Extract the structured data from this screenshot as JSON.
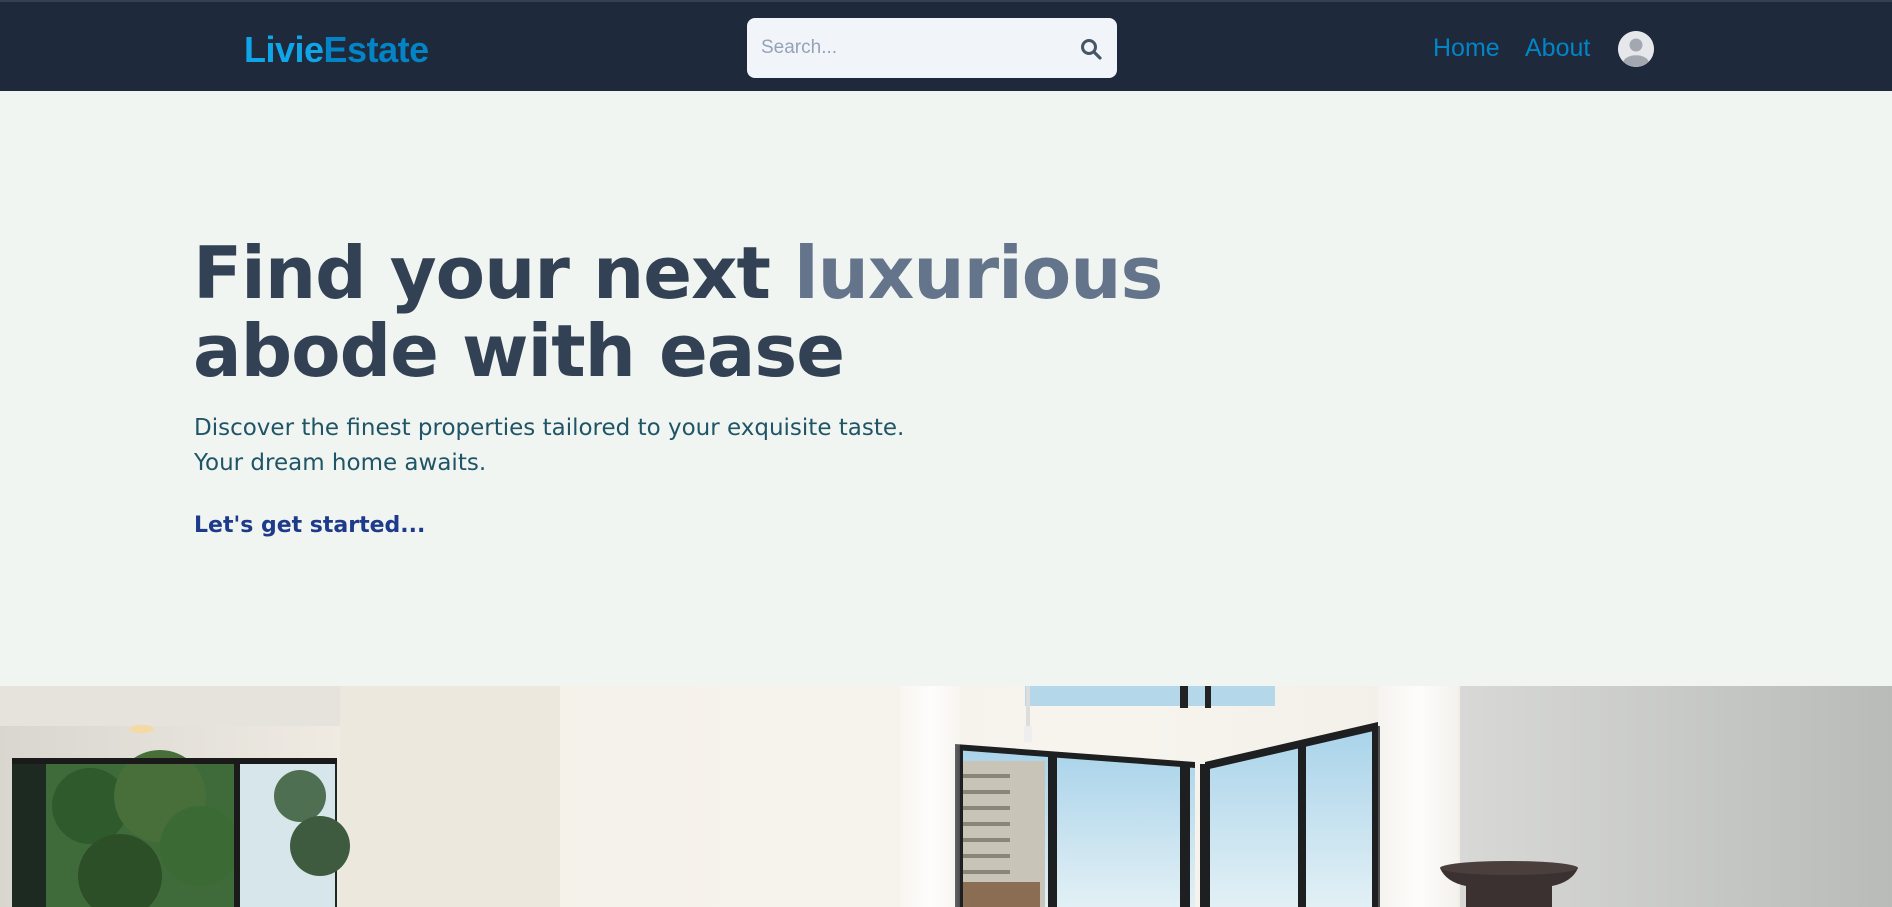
{
  "brand": {
    "part1": "Livie",
    "part2": "Estate"
  },
  "search": {
    "placeholder": "Search..."
  },
  "nav": {
    "home": "Home",
    "about": "About"
  },
  "icons": {
    "search": "search-icon",
    "avatar": "user-avatar-icon"
  },
  "hero": {
    "title_part1": "Find your next ",
    "title_accent": "luxurious",
    "title_part2": "abode with ease",
    "subtitle_line1": "Discover the finest properties tailored to your exquisite taste.",
    "subtitle_line2": "Your dream home awaits.",
    "cta": "Let's get started..."
  },
  "colors": {
    "navbar": "#1e293b",
    "brand_light": "#0ea5e9",
    "brand_dark": "#0284c7",
    "heading": "#334155",
    "heading_accent": "#64748b",
    "subtitle": "#1f5566",
    "cta": "#1e3a8a",
    "page_bg": "#f1f5f1"
  }
}
